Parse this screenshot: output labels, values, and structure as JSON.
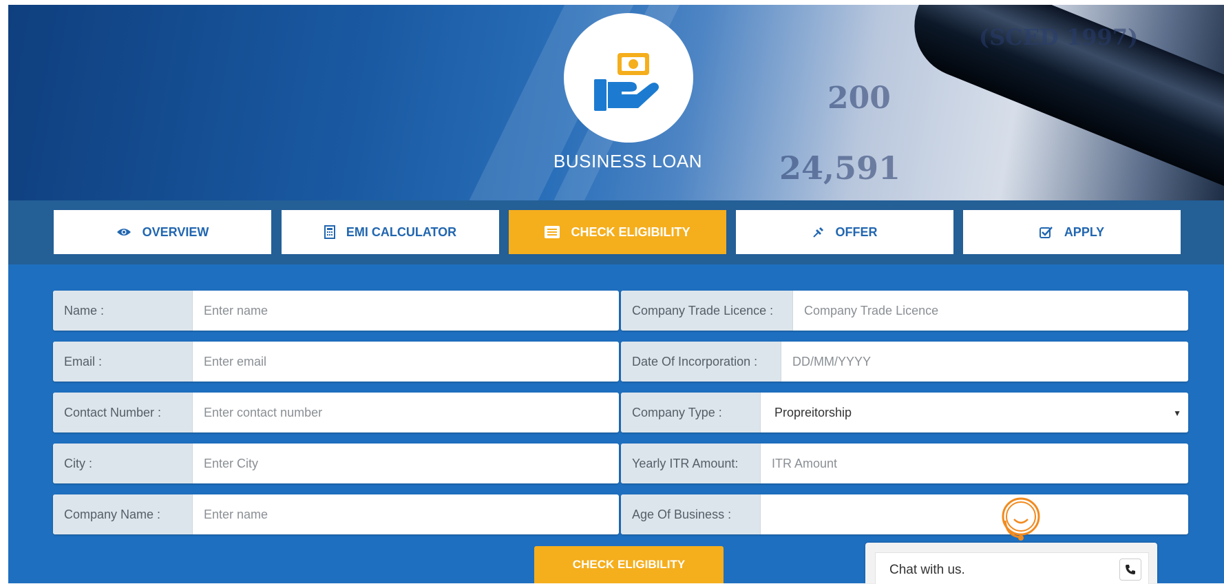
{
  "hero": {
    "title": "BUSINESS LOAN",
    "bg_numbers": [
      "200",
      "24,591",
      "(SCED 1997)"
    ]
  },
  "tabs": [
    {
      "label": "OVERVIEW",
      "icon": "eye-icon",
      "active": false
    },
    {
      "label": "EMI CALCULATOR",
      "icon": "calculator-icon",
      "active": false
    },
    {
      "label": "CHECK ELIGIBILITY",
      "icon": "list-icon",
      "active": true
    },
    {
      "label": "OFFER",
      "icon": "pin-icon",
      "active": false
    },
    {
      "label": "APPLY",
      "icon": "check-square-icon",
      "active": false
    }
  ],
  "form": {
    "name": {
      "label": "Name :",
      "placeholder": "Enter name"
    },
    "email": {
      "label": "Email :",
      "placeholder": "Enter email"
    },
    "contact": {
      "label": "Contact Number :",
      "placeholder": "Enter contact number"
    },
    "city": {
      "label": "City :",
      "placeholder": "Enter City"
    },
    "company_name": {
      "label": "Company Name :",
      "placeholder": "Enter name"
    },
    "trade_licence": {
      "label": "Company Trade Licence :",
      "placeholder": "Company Trade Licence"
    },
    "incorporation": {
      "label": "Date Of Incorporation :",
      "placeholder": "DD/MM/YYYY"
    },
    "company_type": {
      "label": "Company Type :",
      "value": "Propreitorship"
    },
    "itr": {
      "label": "Yearly ITR Amount:",
      "placeholder": "ITR Amount"
    },
    "age": {
      "label": "Age Of Business :",
      "value": ""
    },
    "submit_label": "CHECK ELIGIBILITY"
  },
  "chat": {
    "text": "Chat with us."
  },
  "colors": {
    "accent": "#f5ae1c",
    "primary": "#1e6fbf",
    "tabbar": "#245f96",
    "tab_text": "#2166b0"
  }
}
